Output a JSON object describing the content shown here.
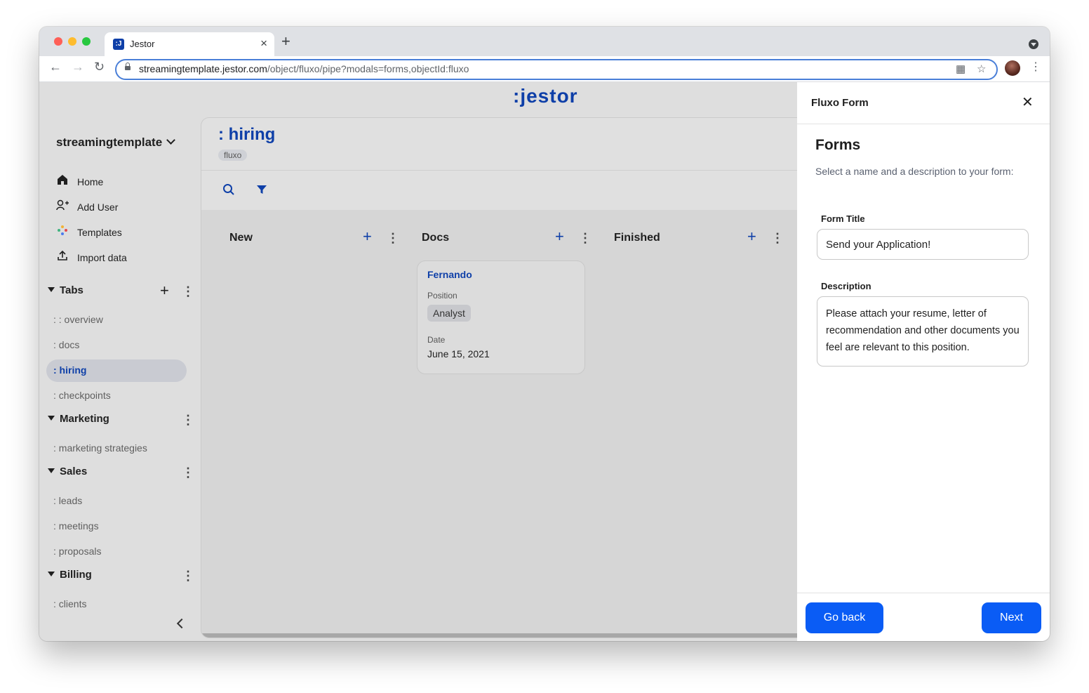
{
  "browser": {
    "tab_title": "Jestor",
    "favicon_text": ":J",
    "url_host": "streamingtemplate.jestor.com",
    "url_path": "/object/fluxo/pipe?modals=forms,objectId:fluxo"
  },
  "app": {
    "logo": ":jestor",
    "workspace": "streamingtemplate"
  },
  "sidebar": {
    "nav": [
      {
        "label": "Home",
        "icon": "home-icon"
      },
      {
        "label": "Add User",
        "icon": "add-user-icon"
      },
      {
        "label": "Templates",
        "icon": "templates-icon"
      },
      {
        "label": "Import data",
        "icon": "upload-icon"
      }
    ],
    "sections": [
      {
        "title": "Tabs",
        "items": [
          ": : overview",
          ": docs",
          ": hiring",
          ": checkpoints"
        ]
      },
      {
        "title": "Marketing",
        "items": [
          ": marketing strategies"
        ]
      },
      {
        "title": "Sales",
        "items": [
          ": leads",
          ": meetings",
          ": proposals"
        ]
      },
      {
        "title": "Billing",
        "items": [
          ": clients"
        ]
      }
    ],
    "active_item": ": hiring"
  },
  "main": {
    "title": ": hiring",
    "badge": "fluxo",
    "columns": [
      {
        "title": "New"
      },
      {
        "title": "Docs"
      },
      {
        "title": "Finished"
      }
    ],
    "card": {
      "title": "Fernando",
      "position_label": "Position",
      "position_value": "Analyst",
      "date_label": "Date",
      "date_value": "June 15, 2021"
    }
  },
  "modal": {
    "title": "Fluxo Form",
    "heading": "Forms",
    "description": "Select a name and a description to your form:",
    "form_title_label": "Form Title",
    "form_title_value": "Send your Application!",
    "description_label": "Description",
    "description_value": "Please attach your resume, letter of recommendation and other documents you feel are relevant to this position.",
    "back_label": "Go back",
    "next_label": "Next"
  },
  "colors": {
    "brand": "#0e3fa8",
    "primary_button": "#0a5cf5"
  }
}
